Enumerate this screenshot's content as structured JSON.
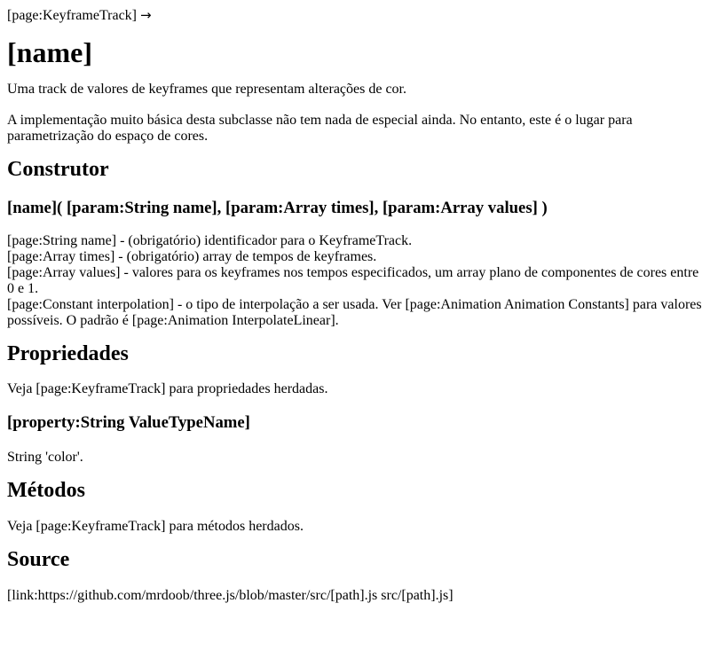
{
  "breadcrumb": {
    "text": "[page:KeyframeTrack]",
    "arrow": "→"
  },
  "title": "[name]",
  "intro": "Uma track de valores de keyframes que representam alterações de cor.",
  "implementation_note": "A implementação muito básica desta subclasse não tem nada de especial ainda. No entanto, este é o lugar para parametrização do espaço de cores.",
  "constructor": {
    "heading": "Construtor",
    "signature": "[name]( [param:String name], [param:Array times], [param:Array values] )",
    "params": [
      "[page:String name] - (obrigatório) identificador para o KeyframeTrack.",
      "[page:Array times] - (obrigatório) array de tempos de keyframes.",
      "[page:Array values] - valores para os keyframes nos tempos especificados, um array plano de componentes de cores entre 0 e 1.",
      "[page:Constant interpolation] - o tipo de interpolação a ser usada. Ver [page:Animation Animation Constants] para valores possíveis. O padrão é [page:Animation InterpolateLinear]."
    ]
  },
  "properties": {
    "heading": "Propriedades",
    "inherited_note": "Veja [page:KeyframeTrack] para propriedades herdadas.",
    "property_heading": "[property:String ValueTypeName]",
    "property_desc": "String 'color'."
  },
  "methods": {
    "heading": "Métodos",
    "inherited_note": "Veja [page:KeyframeTrack] para métodos herdados."
  },
  "source": {
    "heading": "Source",
    "link_text": "[link:https://github.com/mrdoob/three.js/blob/master/src/[path].js src/[path].js]"
  }
}
